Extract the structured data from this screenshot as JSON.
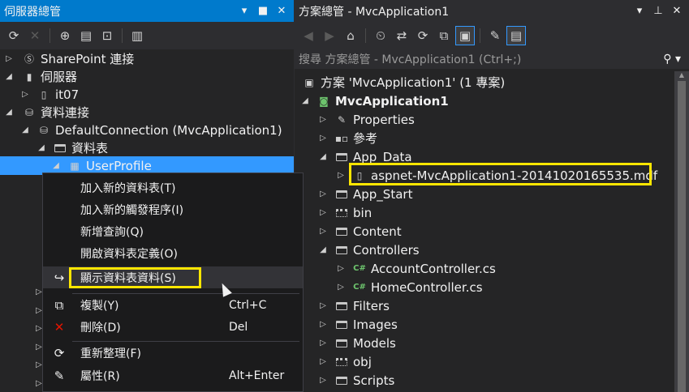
{
  "server_explorer": {
    "title": "伺服器總管",
    "tree": {
      "sharepoint": "SharePoint 連接",
      "servers": "伺服器",
      "server_it07": "it07",
      "data_connections": "資料連接",
      "default_connection": "DefaultConnection (MvcApplication1)",
      "tables": "資料表",
      "user_profile": "UserProfile"
    }
  },
  "context_menu": {
    "items": [
      {
        "label": "加入新的資料表(T)",
        "shortcut": ""
      },
      {
        "label": "加入新的觸發程序(I)",
        "shortcut": ""
      },
      {
        "label": "新增查詢(Q)",
        "shortcut": ""
      },
      {
        "label": "開啟資料表定義(O)",
        "shortcut": ""
      },
      {
        "label": "顯示資料表資料(S)",
        "shortcut": ""
      },
      {
        "label": "複製(Y)",
        "shortcut": "Ctrl+C"
      },
      {
        "label": "刪除(D)",
        "shortcut": "Del"
      },
      {
        "label": "重新整理(F)",
        "shortcut": ""
      },
      {
        "label": "屬性(R)",
        "shortcut": "Alt+Enter"
      }
    ]
  },
  "solution_explorer": {
    "title": "方案總管 - MvcApplication1",
    "search_placeholder": "搜尋 方案總管 - MvcApplication1 (Ctrl+;)",
    "solution": "方案 'MvcApplication1' (1 專案)",
    "project": "MvcApplication1",
    "items": {
      "properties": "Properties",
      "references": "參考",
      "app_data": "App_Data",
      "mdf": "aspnet-MvcApplication1-20141020165535.mdf",
      "app_start": "App_Start",
      "bin": "bin",
      "content": "Content",
      "controllers": "Controllers",
      "account_controller": "AccountController.cs",
      "home_controller": "HomeController.cs",
      "filters": "Filters",
      "images": "Images",
      "models": "Models",
      "obj": "obj",
      "scripts": "Scripts"
    }
  },
  "colors": {
    "accent": "#007acc",
    "selection": "#3399ff",
    "highlight": "#ffe600"
  }
}
